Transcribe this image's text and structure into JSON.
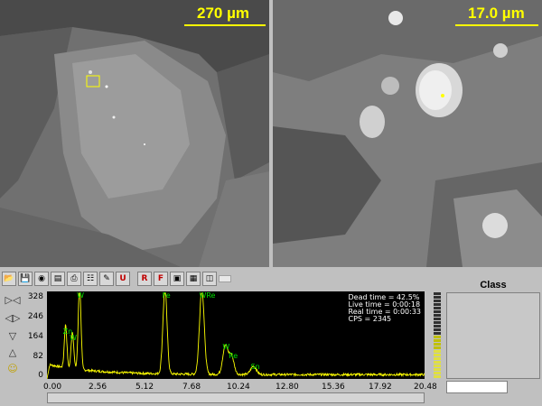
{
  "sem_images": [
    {
      "scale_label": "270 µm"
    },
    {
      "scale_label": "17.0 µm"
    }
  ],
  "toolbar": {
    "icons": [
      "open-icon",
      "save-icon",
      "camera-icon",
      "report-icon",
      "print-icon",
      "copy-icon",
      "edit-icon",
      "unit-icon",
      "spectrum-red-icon",
      "filter-icon",
      "frame-icon",
      "grid-icon",
      "export-icon",
      "blank-icon"
    ],
    "labels": [
      "",
      "",
      "",
      "",
      "",
      "",
      "",
      "U",
      "R",
      "F",
      "",
      "",
      "",
      ""
    ]
  },
  "spectrum": {
    "y_ticks": [
      "328",
      "246",
      "164",
      "82",
      "0"
    ],
    "x_ticks": [
      "0.00",
      "2.56",
      "5.12",
      "7.68",
      "10.24",
      "12.80",
      "15.36",
      "17.92",
      "20.48"
    ],
    "stats": [
      "Dead time = 42.5%",
      "Live time = 0:00:18",
      "Real time = 0:00:33",
      "CPS = 2345"
    ],
    "peaks": [
      {
        "label": "W",
        "energy": 1.77,
        "counts": 328
      },
      {
        "label": "Zn",
        "energy": 1.01,
        "counts": 165
      },
      {
        "label": "W",
        "energy": 1.38,
        "counts": 140
      },
      {
        "label": "Fe",
        "energy": 6.4,
        "counts": 328
      },
      {
        "label": "WRe",
        "energy": 8.4,
        "counts": 328
      },
      {
        "label": "W",
        "energy": 9.67,
        "counts": 108
      },
      {
        "label": "Re",
        "energy": 10.0,
        "counts": 72
      },
      {
        "label": "Sn",
        "energy": 11.2,
        "counts": 32
      }
    ],
    "colors": {
      "line": "#ffff00",
      "bg": "#000000",
      "peak_label": "#00e000"
    }
  },
  "class_panel": {
    "title": "Class"
  }
}
